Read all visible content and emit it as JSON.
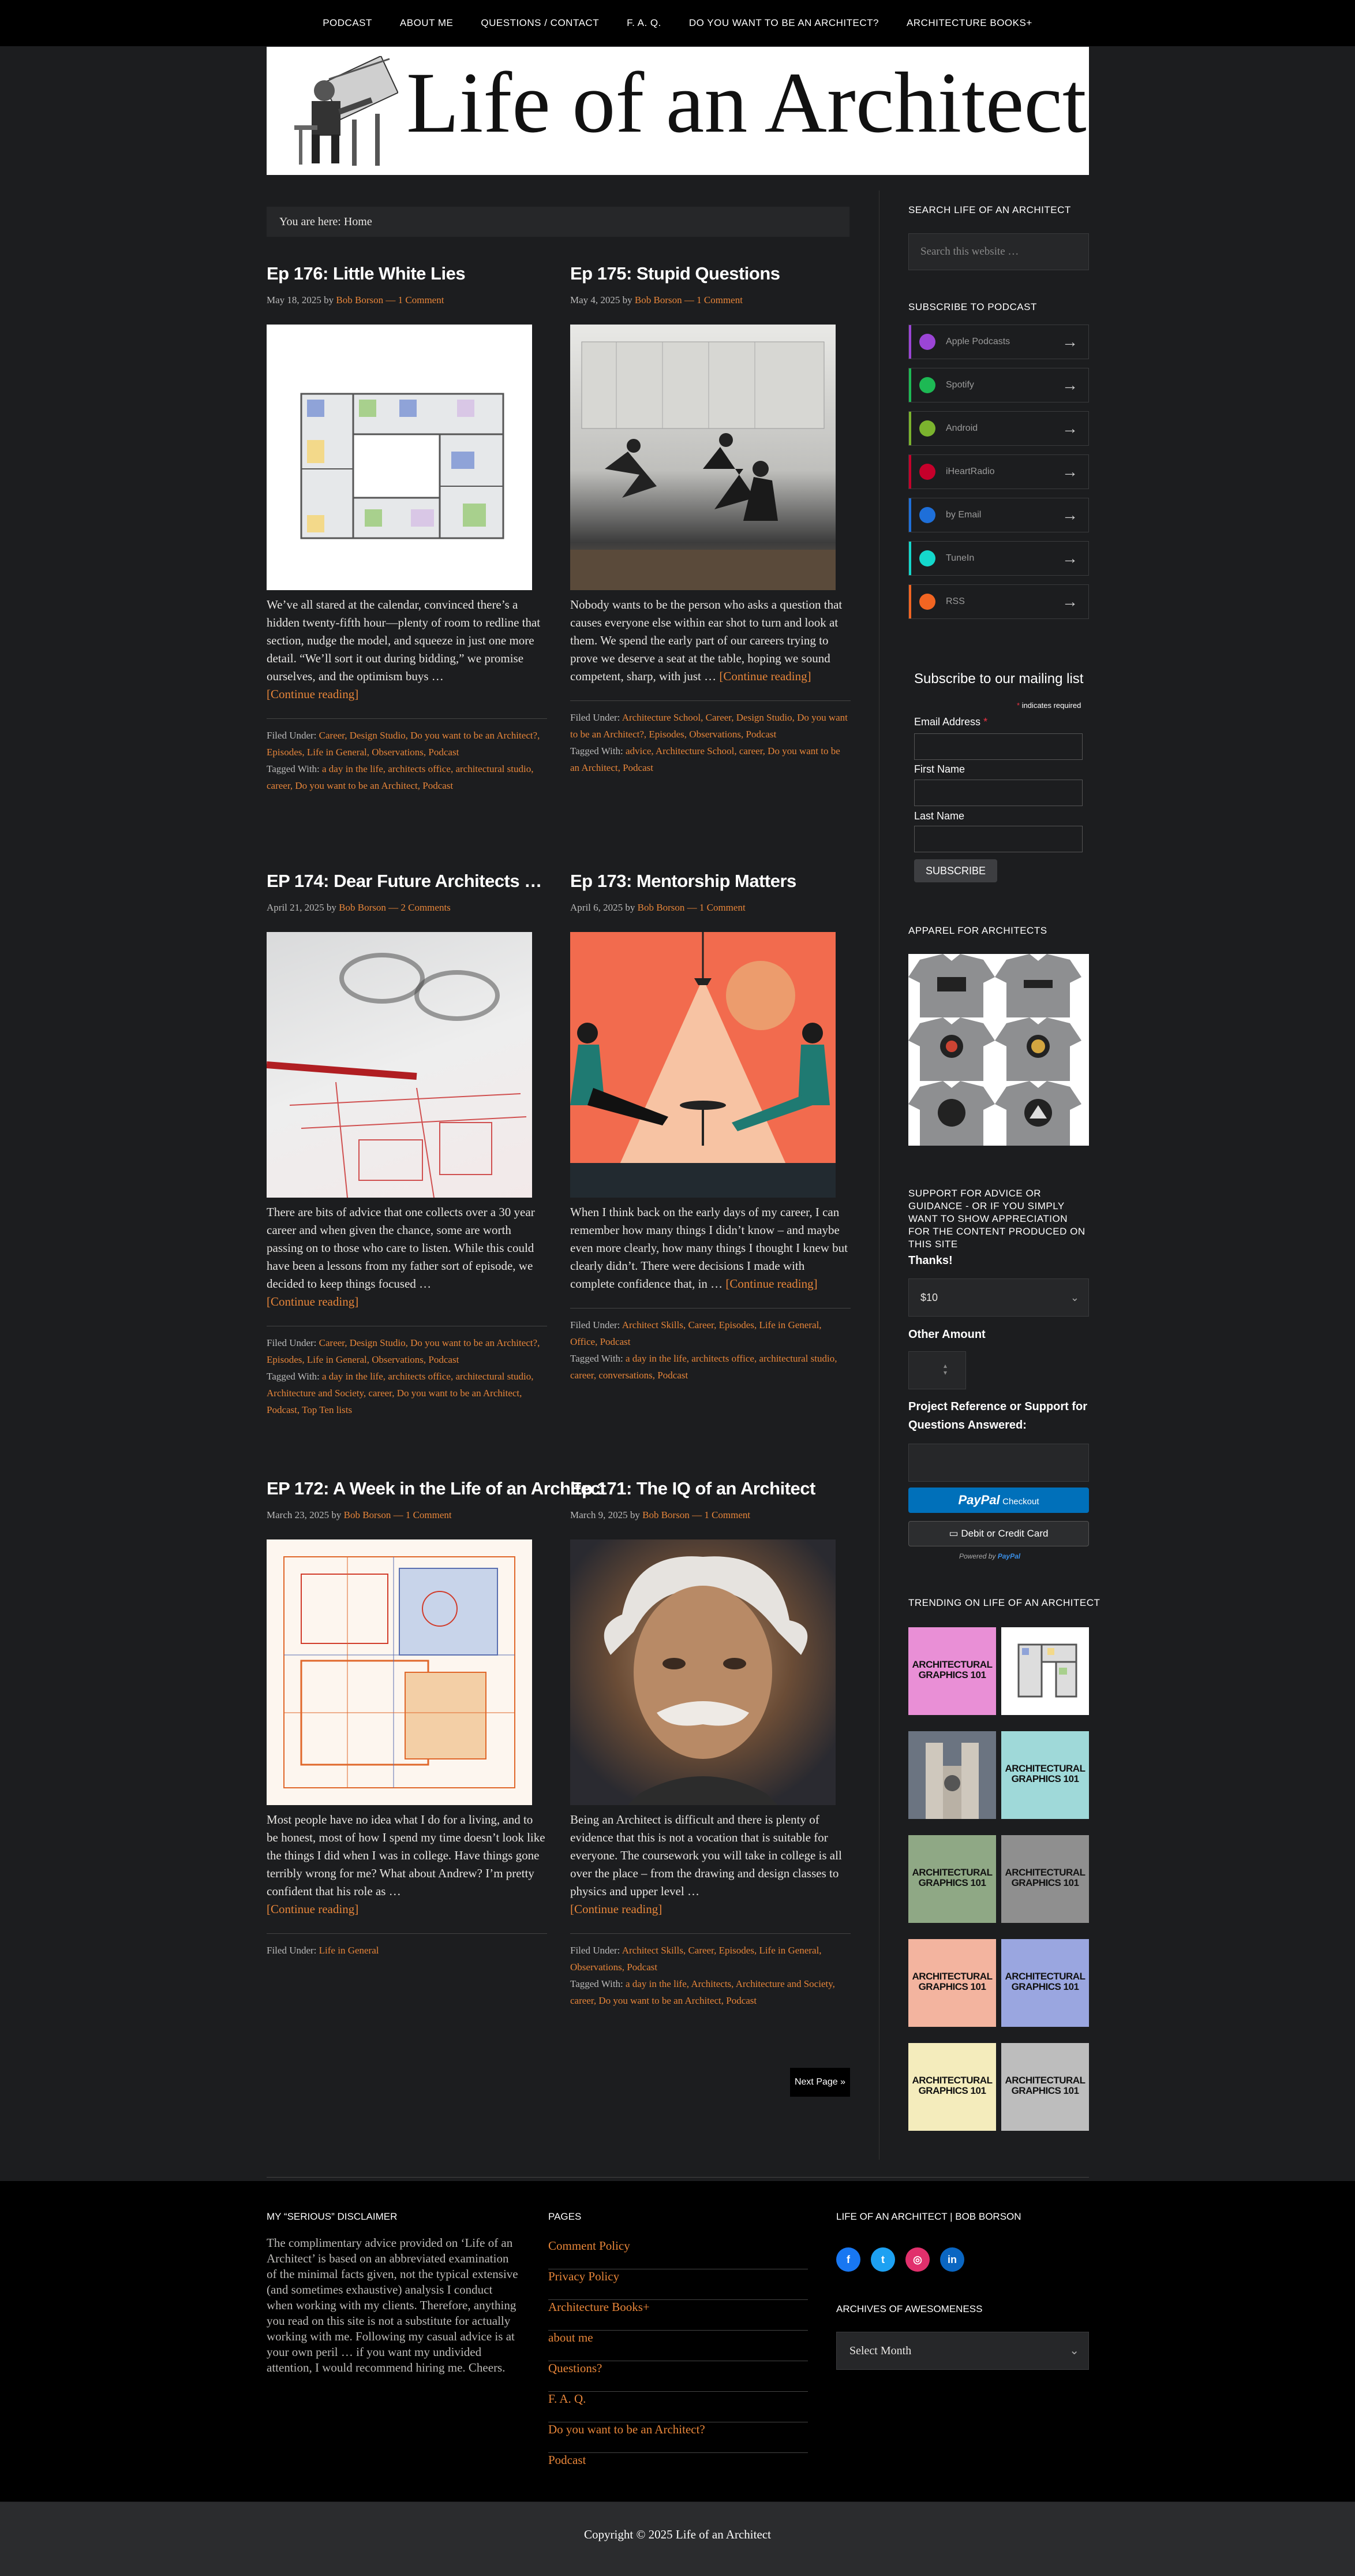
{
  "nav": [
    "PODCAST",
    "ABOUT ME",
    "QUESTIONS / CONTACT",
    "F. A. Q.",
    "DO YOU WANT TO BE AN ARCHITECT?",
    "ARCHITECTURE BOOKS+"
  ],
  "site": {
    "title": "Life of an Architect"
  },
  "breadcrumb": "You are here: Home",
  "posts": [
    {
      "title": "Ep 176: Little White Lies",
      "date": "May 18, 2025",
      "by": "by",
      "author": "Bob Borson",
      "dash": "—",
      "comments": "1 Comment",
      "excerpt": "We’ve all stared at the calendar, convinced there’s a hidden twenty-fifth hour—plenty of room to redline that section, nudge the model, and squeeze in just one more detail. “We’ll sort it out during bidding,” we promise ourselves, and the optimism buys …",
      "more": "[Continue reading]",
      "filed_label": "Filed Under:",
      "filed": "Career, Design Studio, Do you want to be an Architect?, Episodes, Life in General, Observations, Podcast",
      "tagged_label": "Tagged With:",
      "tagged": "a day in the life, architects office, architectural studio, career, Do you want to be an Architect, Podcast"
    },
    {
      "title": "Ep 175: Stupid Questions",
      "date": "May 4, 2025",
      "by": "by",
      "author": "Bob Borson",
      "dash": "—",
      "comments": "1 Comment",
      "excerpt": "Nobody wants to be the person who asks a question that causes everyone else within ear shot to turn and look at them. We spend the early part of our careers trying to prove we deserve a seat at the table, hoping we sound competent, sharp, with just …",
      "more": "[Continue reading]",
      "filed_label": "Filed Under:",
      "filed": "Architecture School, Career, Design Studio, Do you want to be an Architect?, Episodes, Observations, Podcast",
      "tagged_label": "Tagged With:",
      "tagged": "advice, Architecture School, career, Do you want to be an Architect, Podcast"
    },
    {
      "title": "EP 174: Dear Future Architects …",
      "date": "April 21, 2025",
      "by": "by",
      "author": "Bob Borson",
      "dash": "—",
      "comments": "2 Comments",
      "excerpt": "There are bits of advice that one collects over a 30 year career and when given the chance, some are worth passing on to those who care to listen. While this could have been a lessons from my father sort of episode, we decided to keep things focused …",
      "more": "[Continue reading]",
      "filed_label": "Filed Under:",
      "filed": "Career, Design Studio, Do you want to be an Architect?, Episodes, Life in General, Observations, Podcast",
      "tagged_label": "Tagged With:",
      "tagged": "a day in the life, architects office, architectural studio, Architecture and Society, career, Do you want to be an Architect, Podcast, Top Ten lists"
    },
    {
      "title": "Ep 173: Mentorship Matters",
      "date": "April 6, 2025",
      "by": "by",
      "author": "Bob Borson",
      "dash": "—",
      "comments": "1 Comment",
      "excerpt": "When I think back on the early days of my career, I can remember how many things I didn’t know – and maybe even more clearly, how many things I thought I knew but clearly didn’t. There were decisions I made with complete confidence that, in …",
      "more": "[Continue reading]",
      "filed_label": "Filed Under:",
      "filed": "Architect Skills, Career, Episodes, Life in General, Office, Podcast",
      "tagged_label": "Tagged With:",
      "tagged": "a day in the life, architects office, architectural studio, career, conversations, Podcast"
    },
    {
      "title": "EP 172: A Week in the Life of an Architect",
      "date": "March 23, 2025",
      "by": "by",
      "author": "Bob Borson",
      "dash": "—",
      "comments": "1 Comment",
      "excerpt": "Most people have no idea what I do for a living, and to be honest, most of how I spend my time doesn’t look like the things I did when I was in college. Have things gone terribly wrong for me? What about Andrew? I’m pretty confident that his role as …",
      "more": "[Continue reading]",
      "filed_label": "Filed Under:",
      "filed": "Life in General",
      "tagged_label": "",
      "tagged": ""
    },
    {
      "title": "Ep 171: The IQ of an Architect",
      "date": "March 9, 2025",
      "by": "by",
      "author": "Bob Borson",
      "dash": "—",
      "comments": "1 Comment",
      "excerpt": "Being an Architect is difficult and there is plenty of evidence that this is not a vocation that is suitable for everyone. The coursework you will take in college is all over the place – from the drawing and design classes to physics and upper level …",
      "more": "[Continue reading]",
      "filed_label": "Filed Under:",
      "filed": "Architect Skills, Career, Episodes, Life in General, Observations, Podcast",
      "tagged_label": "Tagged With:",
      "tagged": "a day in the life, Architects, Architecture and Society, career, Do you want to be an Architect, Podcast"
    }
  ],
  "next_page": "Next Page »",
  "sidebar": {
    "search_heading": "SEARCH LIFE OF AN ARCHITECT",
    "search_placeholder": "Search this website …",
    "podcast_heading": "SUBSCRIBE TO PODCAST",
    "podcast": [
      {
        "label": "Apple Podcasts",
        "color": "#9b45d6"
      },
      {
        "label": "Spotify",
        "color": "#1db954"
      },
      {
        "label": "Android",
        "color": "#7bb32e"
      },
      {
        "label": "iHeartRadio",
        "color": "#c6002b"
      },
      {
        "label": "by Email",
        "color": "#1e6fd9"
      },
      {
        "label": "TuneIn",
        "color": "#14d8cc"
      },
      {
        "label": "RSS",
        "color": "#f26522"
      }
    ],
    "mailing": {
      "title": "Subscribe to our mailing list",
      "required_note": "indicates required",
      "email": "Email Address",
      "first": "First Name",
      "last": "Last Name",
      "subscribe": "Subscribe"
    },
    "apparel_heading": "APPAREL FOR ARCHITECTS",
    "support_heading": "SUPPORT FOR ADVICE OR GUIDANCE - OR IF YOU SIMPLY WANT TO SHOW APPRECIATION FOR THE CONTENT PRODUCED ON THIS SITE",
    "thanks_label": "Thanks!",
    "thanks_value": "$10",
    "other_label": "Other Amount",
    "project_label": "Project Reference or Support for Questions Answered:",
    "paypal": "PayPal",
    "paypal_checkout": "Checkout",
    "card": "Debit or Credit Card",
    "powered": "Powered by",
    "trending_heading": "TRENDING ON LIFE OF AN ARCHITECT",
    "trending_text": "ARCHITECTURAL GRAPHICS 101"
  },
  "footer": {
    "disclaimer_heading": "MY “SERIOUS” DISCLAIMER",
    "disclaimer": "The complimentary advice provided on ‘Life of an Architect’ is based on an abbreviated examination of the minimal facts given, not the typical extensive (and sometimes exhaustive) analysis I conduct when working with my clients. Therefore, anything you read on this site is not a substitute for actually working with me. Following my casual advice is at your own peril … if you want my undivided attention, I would recommend hiring me. Cheers.",
    "pages_heading": "PAGES",
    "pages": [
      "Comment Policy",
      "Privacy Policy",
      "Architecture Books+",
      "about me",
      "Questions?",
      "F. A. Q.",
      "Do you want to be an Architect?",
      "Podcast"
    ],
    "social_heading": "LIFE OF AN ARCHITECT | BOB BORSON",
    "social": [
      {
        "name": "facebook-icon",
        "color": "#1877f2",
        "glyph": "f"
      },
      {
        "name": "twitter-icon",
        "color": "#1da1f2",
        "glyph": "t"
      },
      {
        "name": "instagram-icon",
        "color": "#e1306c",
        "glyph": "◎"
      },
      {
        "name": "linkedin-icon",
        "color": "#0a66c2",
        "glyph": "in"
      }
    ],
    "archives_heading": "ARCHIVES OF AWESOMENESS",
    "archives_select": "Select Month",
    "copyright": "Copyright © 2025 Life of an Architect"
  },
  "colors": {
    "accent": "#e8863a",
    "bg": "#1c1d1f",
    "nav": "#000000",
    "paypal": "#0070ba"
  }
}
